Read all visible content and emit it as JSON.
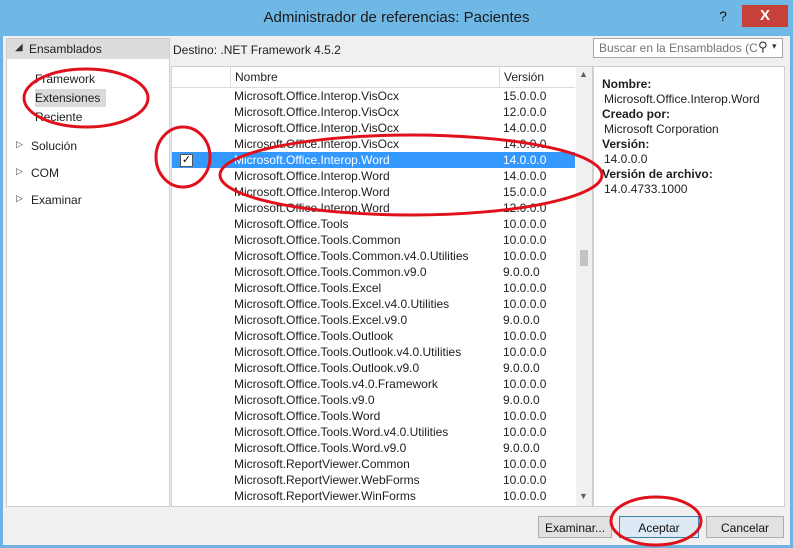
{
  "window": {
    "title": "Administrador de referencias: Pacientes",
    "help_glyph": "?",
    "close_glyph": "X"
  },
  "sidebar": {
    "header": "Ensamblados",
    "subitems": [
      "Framework",
      "Extensiones",
      "Reciente"
    ],
    "selected": "Extensiones",
    "items": [
      "Solución",
      "COM",
      "Examinar"
    ]
  },
  "target": "Destino: .NET Framework 4.5.2",
  "search": {
    "placeholder": "Buscar en la Ensamblados (C"
  },
  "list": {
    "columns": {
      "name": "Nombre",
      "version": "Versión"
    },
    "rows": [
      {
        "name": "Microsoft.Office.Interop.VisOcx",
        "version": "15.0.0.0"
      },
      {
        "name": "Microsoft.Office.Interop.VisOcx",
        "version": "12.0.0.0"
      },
      {
        "name": "Microsoft.Office.Interop.VisOcx",
        "version": "14.0.0.0"
      },
      {
        "name": "Microsoft.Office.Interop.VisOcx",
        "version": "14.0.0.0"
      },
      {
        "name": "Microsoft.Office.Interop.Word",
        "version": "14.0.0.0",
        "checked": true,
        "selected": true
      },
      {
        "name": "Microsoft.Office.Interop.Word",
        "version": "14.0.0.0"
      },
      {
        "name": "Microsoft.Office.Interop.Word",
        "version": "15.0.0.0"
      },
      {
        "name": "Microsoft.Office.Interop.Word",
        "version": "12.0.0.0"
      },
      {
        "name": "Microsoft.Office.Tools",
        "version": "10.0.0.0"
      },
      {
        "name": "Microsoft.Office.Tools.Common",
        "version": "10.0.0.0"
      },
      {
        "name": "Microsoft.Office.Tools.Common.v4.0.Utilities",
        "version": "10.0.0.0"
      },
      {
        "name": "Microsoft.Office.Tools.Common.v9.0",
        "version": "9.0.0.0"
      },
      {
        "name": "Microsoft.Office.Tools.Excel",
        "version": "10.0.0.0"
      },
      {
        "name": "Microsoft.Office.Tools.Excel.v4.0.Utilities",
        "version": "10.0.0.0"
      },
      {
        "name": "Microsoft.Office.Tools.Excel.v9.0",
        "version": "9.0.0.0"
      },
      {
        "name": "Microsoft.Office.Tools.Outlook",
        "version": "10.0.0.0"
      },
      {
        "name": "Microsoft.Office.Tools.Outlook.v4.0.Utilities",
        "version": "10.0.0.0"
      },
      {
        "name": "Microsoft.Office.Tools.Outlook.v9.0",
        "version": "9.0.0.0"
      },
      {
        "name": "Microsoft.Office.Tools.v4.0.Framework",
        "version": "10.0.0.0"
      },
      {
        "name": "Microsoft.Office.Tools.v9.0",
        "version": "9.0.0.0"
      },
      {
        "name": "Microsoft.Office.Tools.Word",
        "version": "10.0.0.0"
      },
      {
        "name": "Microsoft.Office.Tools.Word.v4.0.Utilities",
        "version": "10.0.0.0"
      },
      {
        "name": "Microsoft.Office.Tools.Word.v9.0",
        "version": "9.0.0.0"
      },
      {
        "name": "Microsoft.ReportViewer.Common",
        "version": "10.0.0.0"
      },
      {
        "name": "Microsoft.ReportViewer.WebForms",
        "version": "10.0.0.0"
      },
      {
        "name": "Microsoft.ReportViewer.WinForms",
        "version": "10.0.0.0"
      }
    ]
  },
  "details": {
    "name_label": "Nombre:",
    "name_value": "Microsoft.Office.Interop.Word",
    "created_label": "Creado por:",
    "created_value": "Microsoft Corporation",
    "version_label": "Versión:",
    "version_value": "14.0.0.0",
    "file_version_label": "Versión de archivo:",
    "file_version_value": "14.0.4733.1000"
  },
  "buttons": {
    "browse": "Examinar...",
    "ok": "Aceptar",
    "cancel": "Cancelar"
  },
  "icons": {
    "search": "search-icon",
    "expand": "triangle-right-icon",
    "collapse": "triangle-down-icon",
    "checkbox": "checkmark-icon"
  },
  "colors": {
    "selection": "#3399ff",
    "annotation": "#e0111c",
    "title_bar": "#6fb8e6"
  }
}
